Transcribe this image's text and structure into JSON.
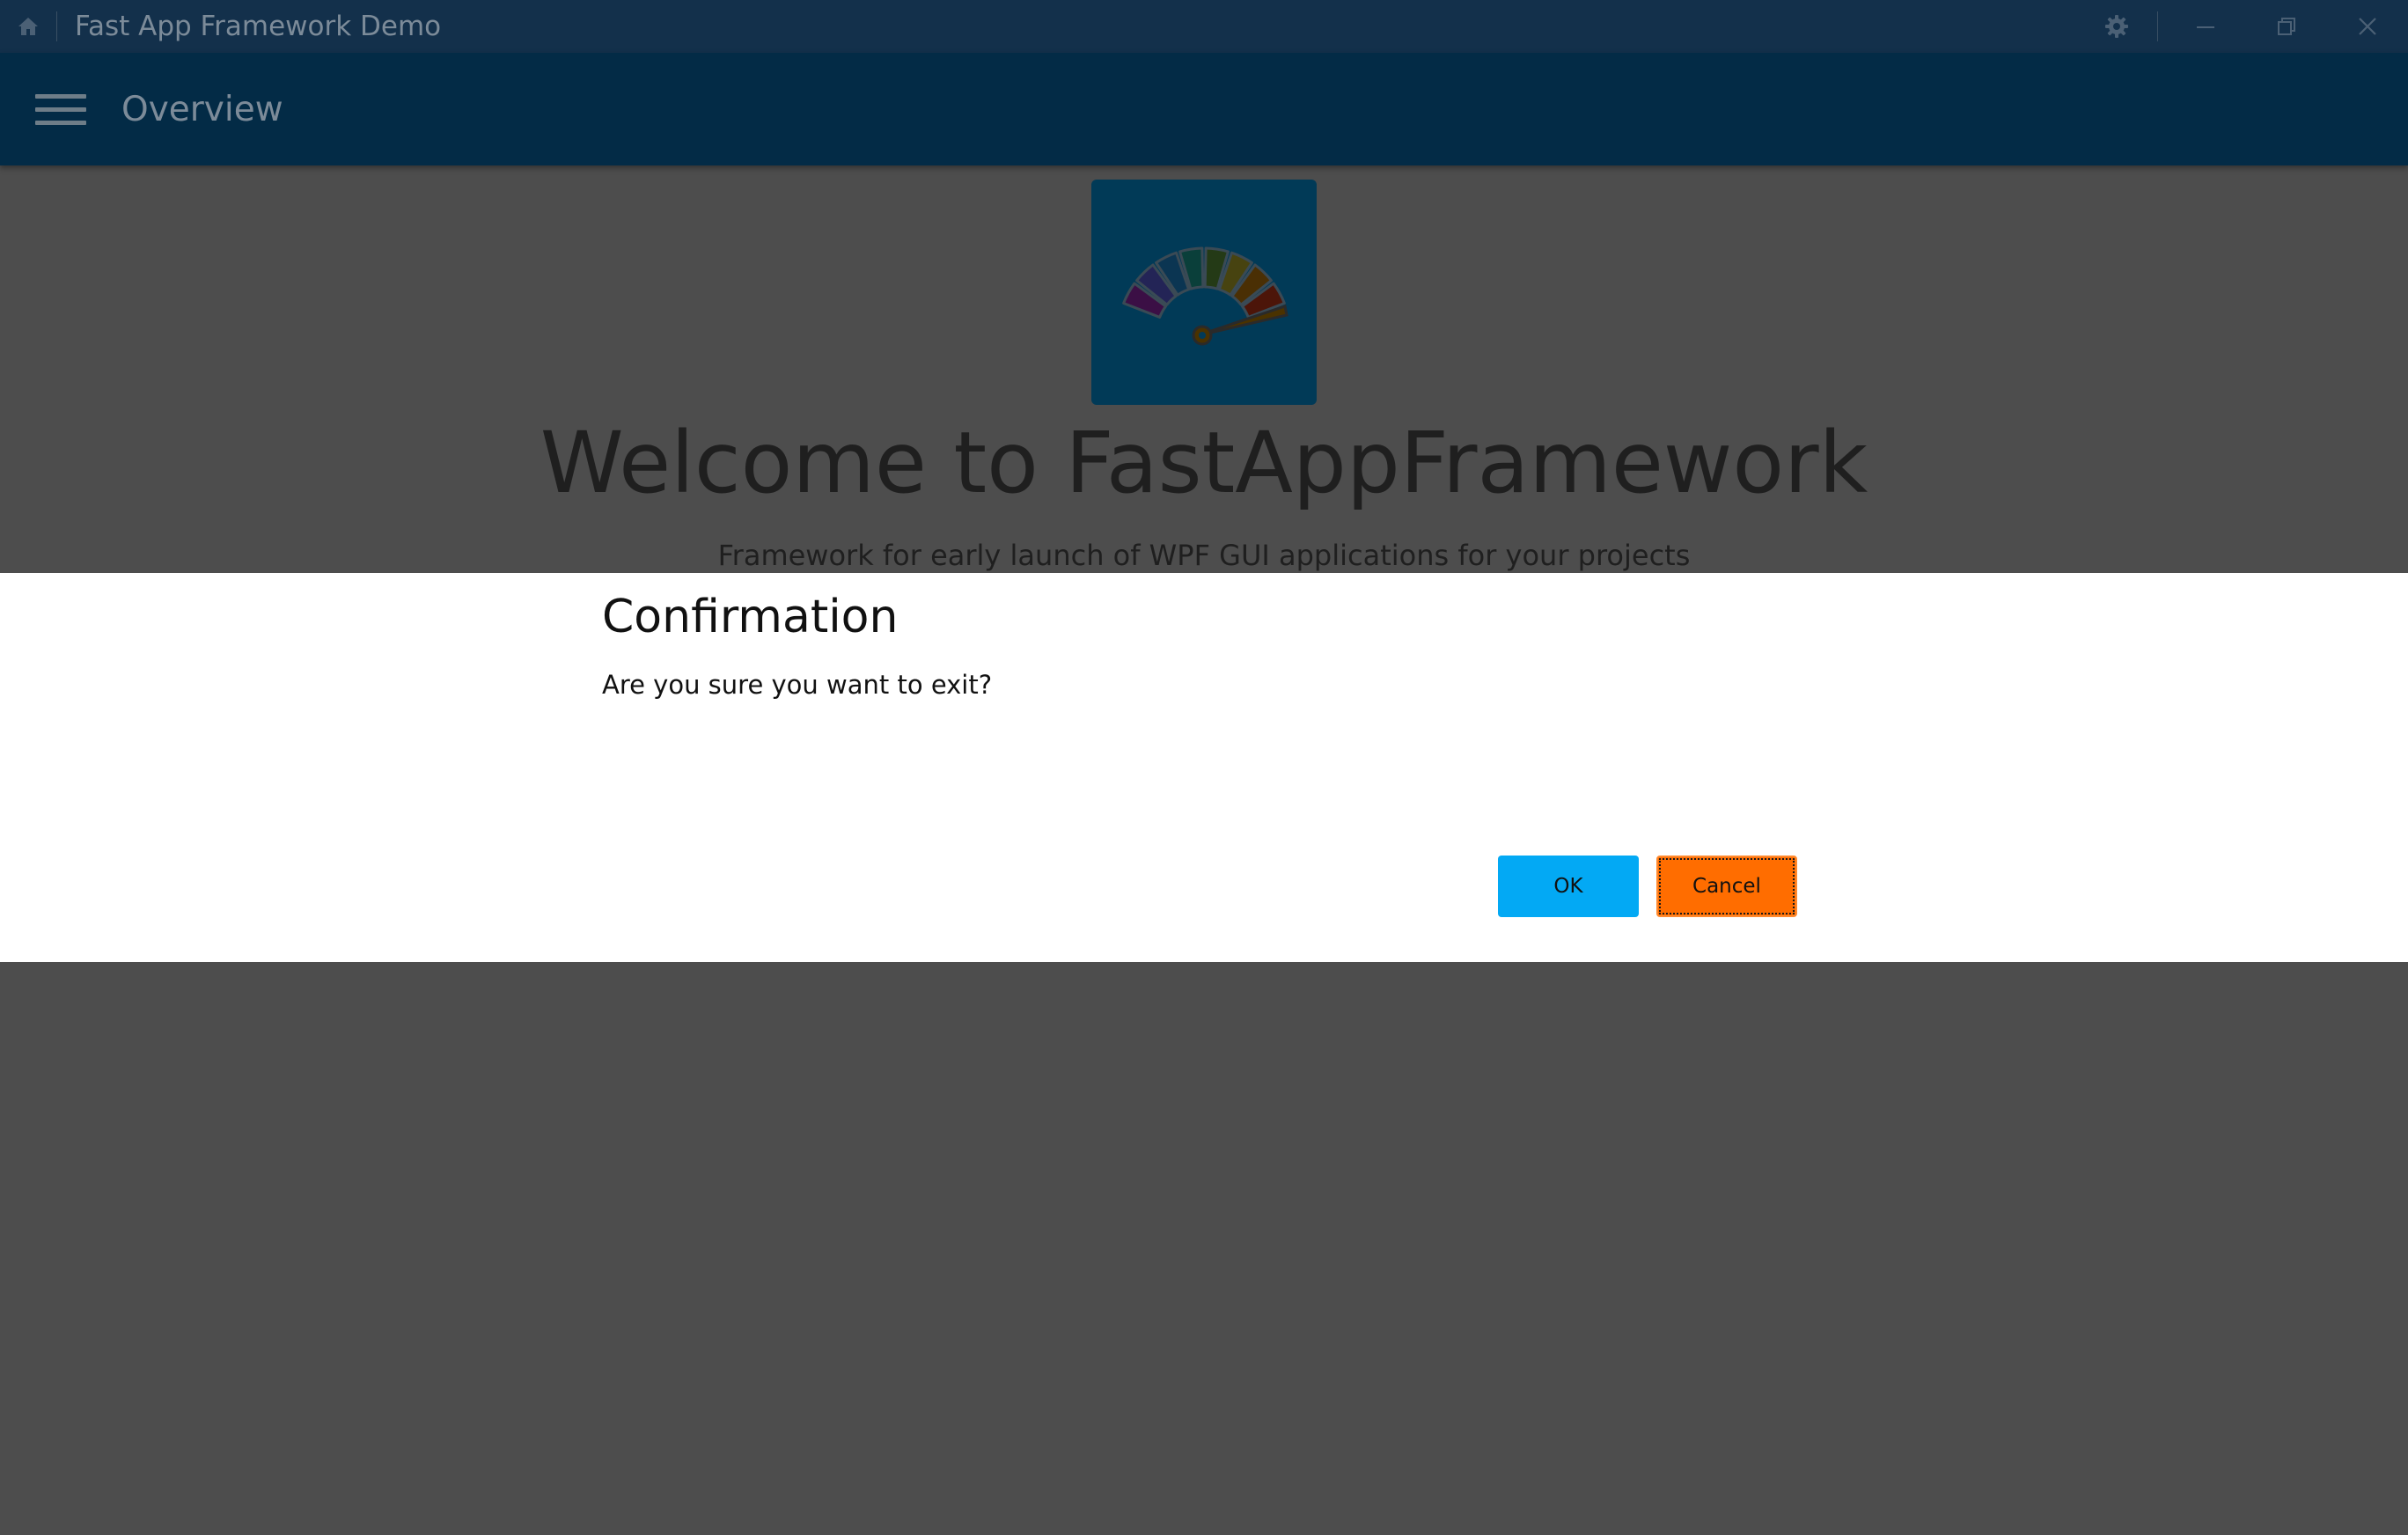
{
  "window": {
    "title": "Fast App Framework Demo",
    "icons": [
      "home-icon",
      "settings-icon",
      "minimize-icon",
      "restore-icon",
      "close-icon"
    ]
  },
  "appbar": {
    "title": "Overview",
    "menu_icon": "hamburger-menu-icon"
  },
  "content": {
    "heading": "Welcome to FastAppFramework",
    "subtitle": "Framework for early launch of WPF GUI applications for your projects"
  },
  "dialog": {
    "title": "Confirmation",
    "message": "Are you sure you want to exit?",
    "ok_label": "OK",
    "cancel_label": "Cancel"
  },
  "colors": {
    "titlebar": "#13304b",
    "appbar": "#032b46",
    "overlay": "#4d4d4d",
    "ok_button": "#03a9f4",
    "cancel_button": "#ff6d00"
  }
}
